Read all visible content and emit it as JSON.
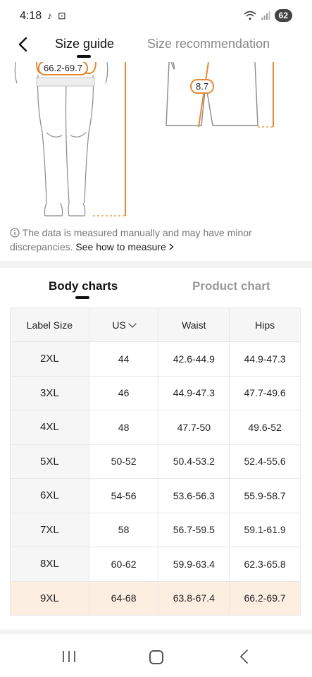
{
  "status": {
    "time": "4:18",
    "battery": "62",
    "left_icons": [
      "tiktok-icon",
      "screenshot-icon"
    ],
    "right_icons": [
      "wifi-icon",
      "signal-icon"
    ]
  },
  "nav": {
    "back_icon": "chevron-left-icon",
    "tab_size_guide": "Size guide",
    "tab_size_recommendation": "Size recommendation",
    "active_tab": "Size guide"
  },
  "illustration": {
    "hips_label": "66.2-69.7",
    "leg_label": "8.7",
    "accent_color": "#e38a33"
  },
  "note": {
    "icon": "info-icon",
    "text": "The data is measured manually and may have minor discrepancies.",
    "link": "See how to measure",
    "link_icon": "chevron-right-icon"
  },
  "chart_tabs": {
    "body": "Body charts",
    "product": "Product chart",
    "active": "Body charts"
  },
  "table": {
    "headers": [
      "Label Size",
      "US",
      "Waist",
      "Hips"
    ],
    "sort_icon": "chevron-down-icon",
    "rows": [
      [
        "2XL",
        "44",
        "42.6-44.9",
        "44.9-47.3"
      ],
      [
        "3XL",
        "46",
        "44.9-47.3",
        "47.7-49.6"
      ],
      [
        "4XL",
        "48",
        "47.7-50",
        "49.6-52"
      ],
      [
        "5XL",
        "50-52",
        "50.4-53.2",
        "52.4-55.6"
      ],
      [
        "6XL",
        "54-56",
        "53.6-56.3",
        "55.9-58.7"
      ],
      [
        "7XL",
        "58",
        "56.7-59.5",
        "59.1-61.9"
      ],
      [
        "8XL",
        "60-62",
        "59.9-63.4",
        "62.3-65.8"
      ],
      [
        "9XL",
        "64-68",
        "63.8-67.4",
        "66.2-69.7"
      ]
    ],
    "highlighted_row": "9XL",
    "highlight_color": "#fdeee2"
  },
  "system_nav": {
    "recent_icon": "recent-apps-icon",
    "home_icon": "home-icon",
    "back_icon": "back-icon"
  }
}
